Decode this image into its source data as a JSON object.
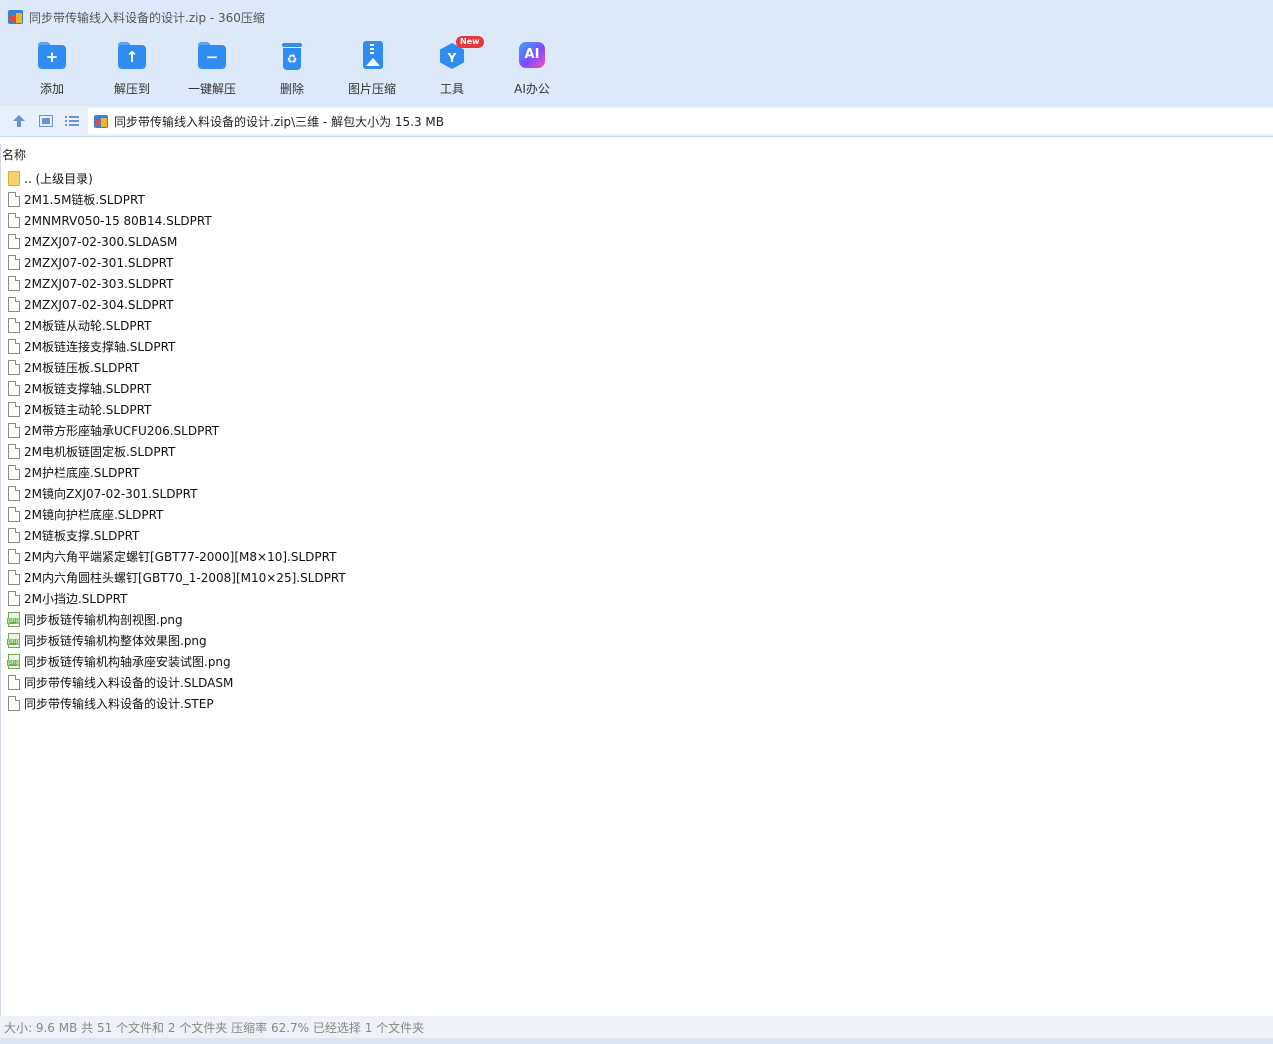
{
  "window": {
    "title": "同步带传输线入料设备的设计.zip - 360压缩"
  },
  "toolbar": {
    "buttons": [
      {
        "label": "添加",
        "icon": "add-folder-icon"
      },
      {
        "label": "解压到",
        "icon": "extract-to-icon"
      },
      {
        "label": "一键解压",
        "icon": "one-click-extract-icon"
      },
      {
        "label": "删除",
        "icon": "recycle-bin-icon"
      },
      {
        "label": "图片压缩",
        "icon": "image-compress-icon"
      },
      {
        "label": "工具",
        "icon": "tools-icon",
        "badge": "New"
      },
      {
        "label": "AI办公",
        "icon": "ai-office-icon",
        "glyph": "AI"
      }
    ]
  },
  "navbar": {
    "path": "同步带传输线入料设备的设计.zip\\三维 - 解包大小为 15.3 MB"
  },
  "list": {
    "column_name": "名称",
    "items": [
      {
        "name": ".. (上级目录)",
        "type": "folder"
      },
      {
        "name": "2M1.5M链板.SLDPRT",
        "type": "doc"
      },
      {
        "name": "2MNMRV050-15 80B14.SLDPRT",
        "type": "doc"
      },
      {
        "name": "2MZXJ07-02-300.SLDASM",
        "type": "doc"
      },
      {
        "name": "2MZXJ07-02-301.SLDPRT",
        "type": "doc"
      },
      {
        "name": "2MZXJ07-02-303.SLDPRT",
        "type": "doc"
      },
      {
        "name": "2MZXJ07-02-304.SLDPRT",
        "type": "doc"
      },
      {
        "name": "2M板链从动轮.SLDPRT",
        "type": "doc"
      },
      {
        "name": "2M板链连接支撑轴.SLDPRT",
        "type": "doc"
      },
      {
        "name": "2M板链压板.SLDPRT",
        "type": "doc"
      },
      {
        "name": "2M板链支撑轴.SLDPRT",
        "type": "doc"
      },
      {
        "name": "2M板链主动轮.SLDPRT",
        "type": "doc"
      },
      {
        "name": "2M带方形座轴承UCFU206.SLDPRT",
        "type": "doc"
      },
      {
        "name": "2M电机板链固定板.SLDPRT",
        "type": "doc"
      },
      {
        "name": "2M护栏底座.SLDPRT",
        "type": "doc"
      },
      {
        "name": "2M镜向ZXJ07-02-301.SLDPRT",
        "type": "doc"
      },
      {
        "name": "2M镜向护栏底座.SLDPRT",
        "type": "doc"
      },
      {
        "name": "2M链板支撑.SLDPRT",
        "type": "doc"
      },
      {
        "name": "2M内六角平端紧定螺钉[GBT77-2000][M8×10].SLDPRT",
        "type": "doc"
      },
      {
        "name": "2M内六角圆柱头螺钉[GBT70_1-2008][M10×25].SLDPRT",
        "type": "doc"
      },
      {
        "name": "2M小挡边.SLDPRT",
        "type": "doc"
      },
      {
        "name": "同步板链传输机构剖视图.png",
        "type": "png"
      },
      {
        "name": "同步板链传输机构整体效果图.png",
        "type": "png"
      },
      {
        "name": "同步板链传输机构轴承座安装试图.png",
        "type": "png"
      },
      {
        "name": "同步带传输线入料设备的设计.SLDASM",
        "type": "doc"
      },
      {
        "name": "同步带传输线入料设备的设计.STEP",
        "type": "doc"
      }
    ]
  },
  "status": {
    "text": "大小: 9.6 MB 共 51 个文件和 2 个文件夹 压缩率 62.7% 已经选择 1 个文件夹"
  },
  "colors": {
    "toolbar_bg": "#dde9f8",
    "icon_blue": "#2f8cf0",
    "badge_red": "#e8383b"
  }
}
